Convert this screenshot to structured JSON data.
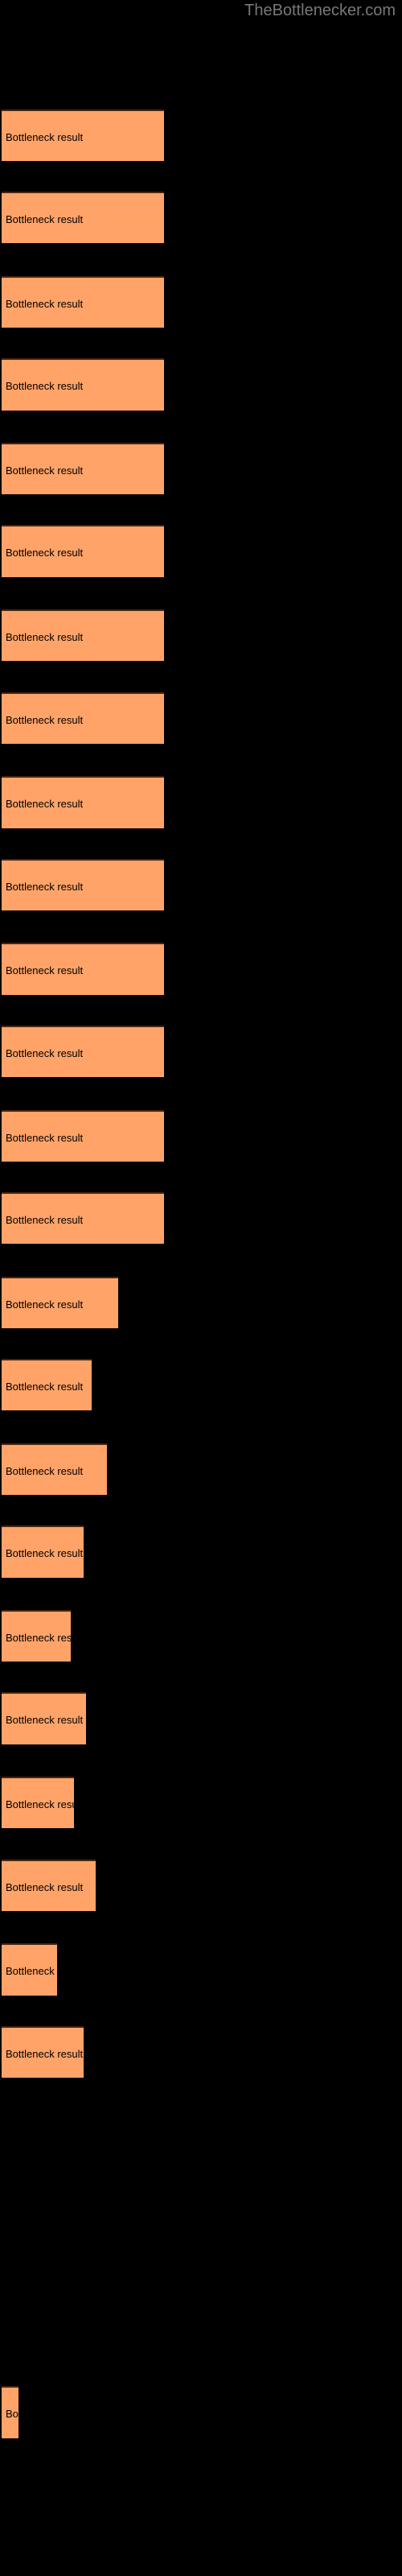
{
  "chart": {
    "title": "TheBottlenecker.com",
    "background_color": "#000000",
    "title_color": "#787878",
    "bar_color": "#FFA368",
    "bar_border_color": "#4a2410",
    "label_color": "#000000"
  },
  "chart_data": {
    "type": "bar",
    "orientation": "horizontal",
    "title": "TheBottlenecker.com",
    "xlabel": "",
    "ylabel": "",
    "grid": false,
    "legend": false,
    "categories": [
      "",
      "",
      "",
      "",
      "",
      "",
      "",
      "",
      "",
      "",
      "",
      "",
      "",
      "",
      "",
      "",
      "",
      "",
      "",
      "",
      "",
      ""
    ],
    "bar_label": "Bottleneck result",
    "values": [
      85,
      85,
      85,
      85,
      85,
      85,
      85,
      85,
      85,
      85,
      85,
      85,
      85,
      61,
      47,
      55,
      43,
      36,
      44,
      38,
      49,
      29,
      43,
      9
    ],
    "xlim": [
      0,
      500
    ],
    "bars": [
      {
        "y": 57,
        "width": 85,
        "label": "Bottleneck result"
      },
      {
        "y": 100,
        "width": 85,
        "label": "Bottleneck result"
      },
      {
        "y": 144,
        "width": 85,
        "label": "Bottleneck result"
      },
      {
        "y": 187,
        "width": 85,
        "label": "Bottleneck result"
      },
      {
        "y": 231,
        "width": 85,
        "label": "Bottleneck result"
      },
      {
        "y": 274,
        "width": 85,
        "label": "Bottleneck result"
      },
      {
        "y": 318,
        "width": 85,
        "label": "Bottleneck result"
      },
      {
        "y": 361,
        "width": 85,
        "label": "Bottleneck result"
      },
      {
        "y": 405,
        "width": 85,
        "label": "Bottleneck result"
      },
      {
        "y": 448,
        "width": 85,
        "label": "Bottleneck result"
      },
      {
        "y": 492,
        "width": 85,
        "label": "Bottleneck result"
      },
      {
        "y": 535,
        "width": 85,
        "label": "Bottleneck result"
      },
      {
        "y": 579,
        "width": 85,
        "label": "Bottleneck result"
      },
      {
        "y": 622,
        "width": 85,
        "label": "Bottleneck result"
      },
      {
        "y": 666,
        "width": 61,
        "label": "Bottleneck result"
      },
      {
        "y": 709,
        "width": 47,
        "label": "Bottleneck result"
      },
      {
        "y": 753,
        "width": 55,
        "label": "Bottleneck result"
      },
      {
        "y": 796,
        "width": 43,
        "label": "Bottleneck result"
      },
      {
        "y": 840,
        "width": 36,
        "label": "Bottleneck result"
      },
      {
        "y": 883,
        "width": 44,
        "label": "Bottleneck result"
      },
      {
        "y": 927,
        "width": 38,
        "label": "Bottleneck result"
      },
      {
        "y": 970,
        "width": 49,
        "label": "Bottleneck result"
      },
      {
        "y": 1014,
        "width": 29,
        "label": "Bottleneck result"
      },
      {
        "y": 1057,
        "width": 43,
        "label": "Bottleneck result"
      },
      {
        "y": 1245,
        "width": 9,
        "label": "Bottleneck result"
      }
    ],
    "scale_factor": 2.381
  }
}
